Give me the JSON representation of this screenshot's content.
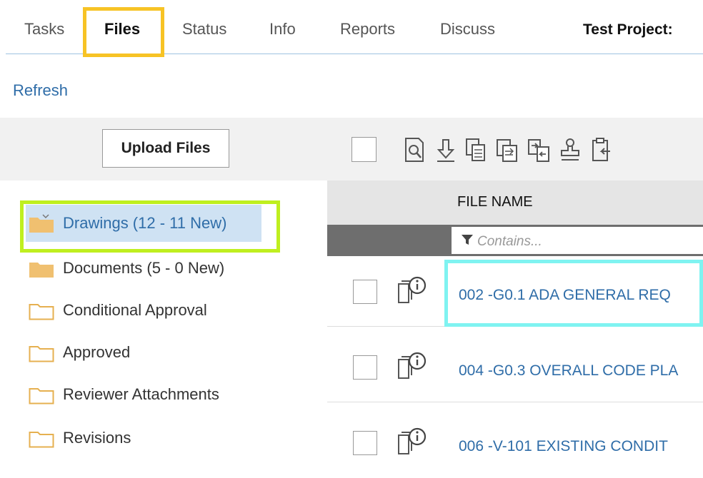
{
  "tabs": [
    {
      "label": "Tasks"
    },
    {
      "label": "Files",
      "active": true
    },
    {
      "label": "Status"
    },
    {
      "label": "Info"
    },
    {
      "label": "Reports"
    },
    {
      "label": "Discuss"
    }
  ],
  "project_label": "Test Project:",
  "refresh_label": "Refresh",
  "upload_label": "Upload Files",
  "toolbar_icons": [
    "search-document-icon",
    "download-icon",
    "copy-icon",
    "paste-icon",
    "compare-icon",
    "stamp-icon",
    "clipboard-icon"
  ],
  "folders": [
    {
      "label": "Drawings (12 - 11 New)",
      "icon": "folder-open-icon",
      "selected": true
    },
    {
      "label": "Documents (5 - 0 New)",
      "icon": "folder-filled-icon"
    },
    {
      "label": "Conditional Approval",
      "icon": "folder-outline-icon"
    },
    {
      "label": "Approved",
      "icon": "folder-outline-icon"
    },
    {
      "label": "Reviewer Attachments",
      "icon": "folder-outline-icon"
    },
    {
      "label": "Revisions",
      "icon": "folder-outline-icon"
    }
  ],
  "grid": {
    "column_header": "FILE NAME",
    "filter_placeholder": "Contains...",
    "rows": [
      {
        "file_name": "002 -G0.1 ADA GENERAL REQ"
      },
      {
        "file_name": "004 -G0.3 OVERALL CODE PLA"
      },
      {
        "file_name": "006 -V-101 EXISTING CONDIT"
      }
    ]
  },
  "colors": {
    "link": "#2f6da8",
    "folder": "#f0c070",
    "selected_bg": "#cfe2f3",
    "highlight_yellow": "#f7c325",
    "highlight_green": "#bfef1f",
    "highlight_cyan": "#7ff3f1"
  }
}
